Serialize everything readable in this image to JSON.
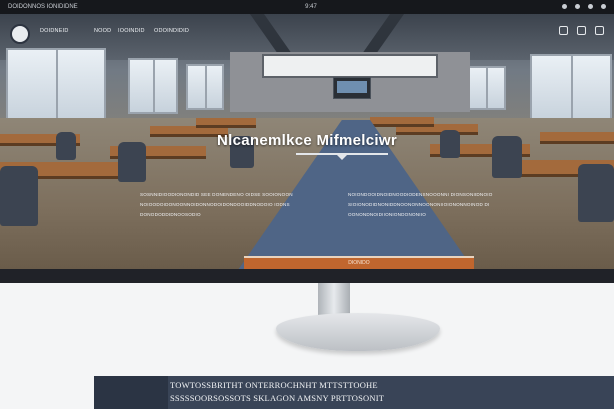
{
  "statusbar": {
    "left": "DOIDONNOS IONIDIDNE",
    "center": "9:47"
  },
  "nav": {
    "links": [
      "DOIDNEID",
      "NOOD",
      "IOOINDID",
      "ODOINDIDID"
    ]
  },
  "hero": {
    "title": "Nlcanemlkce Mifmelciwr",
    "body_left": [
      "SOSNNIDIOODIONONDID SEE DONENDENO OIDSE SOOIONOON",
      "NOIOODOIDONOONNOIDONNODOIDONDOOIDDNODOIO IODNS",
      "DONODODDIDNOOSODIO"
    ],
    "body_right": [
      "NOIONDOOIDNOIDNOODIODENSNOOONNI DIONSONIIDNOIO",
      "SIOIONODIDNONIDDNOONONNOONONIIOIONONNOINOD DI",
      "OONONDNOIDIIONIONDONONIIO"
    ],
    "cta": "DIONIDO"
  },
  "banner": {
    "line1": "TOWTOSSBRITHT ONTERROCHNHT MTTSTTOOHE",
    "line2": "SSSSSOORSOSSOTS SKLAGON AMSNY PRTTOSONIT"
  },
  "colors": {
    "accent": "#c0662e",
    "aisle": "#4f6586",
    "banner": "#394457"
  }
}
